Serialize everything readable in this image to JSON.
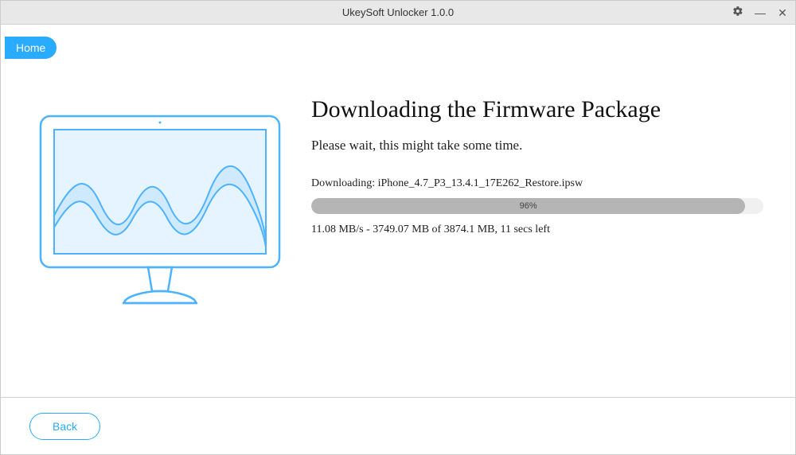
{
  "titlebar": {
    "title": "UkeySoft Unlocker 1.0.0"
  },
  "nav": {
    "home_label": "Home"
  },
  "page": {
    "heading": "Downloading the Firmware Package",
    "subheading": "Please wait, this might take some time.",
    "download_prefix": "Downloading: ",
    "download_file": "iPhone_4.7_P3_13.4.1_17E262_Restore.ipsw",
    "progress_percent": 96,
    "progress_label": "96%",
    "status_line": "11.08 MB/s - 3749.07 MB of 3874.1 MB, 11 secs left"
  },
  "footer": {
    "back_label": "Back"
  },
  "colors": {
    "accent": "#29abff",
    "progress_fill": "#b5b5b5"
  }
}
